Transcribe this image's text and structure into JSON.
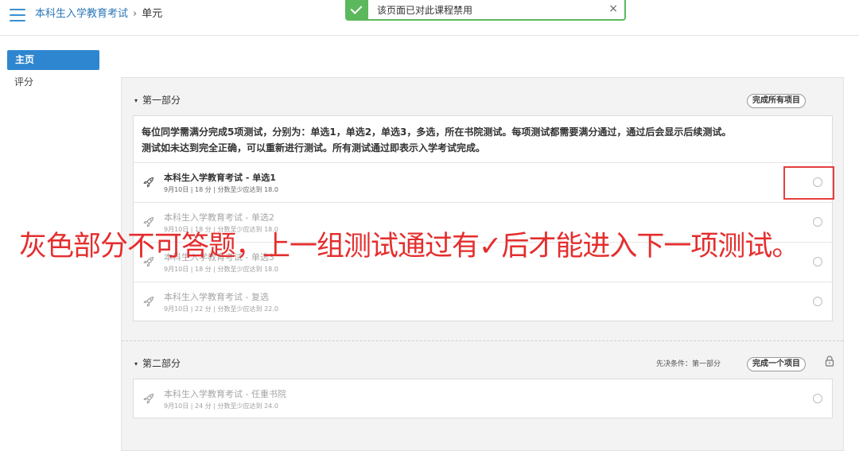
{
  "header": {
    "breadcrumb": {
      "course": "本科生入学教育考试",
      "separator": "›",
      "current": "单元"
    }
  },
  "toast": {
    "message": "该页面已对此课程禁用",
    "close": "×"
  },
  "sidebar": {
    "items": [
      {
        "label": "主页",
        "active": true
      },
      {
        "label": "评分",
        "active": false
      }
    ]
  },
  "section1": {
    "title": "第一部分",
    "toggle_icon": "▾",
    "complete_pill": "完成所有项目",
    "description_line1": "每位同学需满分完成5项测试，分别为：单选1，单选2，单选3，多选，所在书院测试。每项测试都需要满分通过，通过后会显示后续测试。",
    "description_line2": "测试如未达到完全正确，可以重新进行测试。所有测试通过即表示入学考试完成。",
    "items": [
      {
        "title": "本科生入学教育考试 - 单选1",
        "meta": "9月10日 | 18 分 | 分数至少应达到 18.0",
        "enabled": true
      },
      {
        "title": "本科生入学教育考试 - 单选2",
        "meta": "9月10日 | 18 分 | 分数至少应达到 18.0",
        "enabled": false
      },
      {
        "title": "本科生入学教育考试 - 单选3",
        "meta": "9月10日 | 18 分 | 分数至少应达到 18.0",
        "enabled": false
      },
      {
        "title": "本科生入学教育考试 - 复选",
        "meta": "9月10日 | 22 分 | 分数至少应达到 22.0",
        "enabled": false
      }
    ]
  },
  "section2": {
    "title": "第二部分",
    "toggle_icon": "▾",
    "prerequisite": "先决条件：第一部分",
    "complete_pill": "完成一个项目",
    "items": [
      {
        "title": "本科生入学教育考试 - 任重书院",
        "meta": "9月10日 | 24 分 | 分数至少应达到 24.0",
        "enabled": false
      }
    ]
  },
  "annotation": {
    "text": "灰色部分不可答题，上一组测试通过有✓后才能进入下一项测试。",
    "color": "#e42e2e"
  },
  "colors": {
    "accent": "#2f86d0",
    "success": "#5cb85c",
    "highlight": "#e53f3f"
  },
  "icons": [
    "hamburger-icon",
    "check-icon",
    "close-icon",
    "rocket-icon",
    "lock-icon"
  ]
}
